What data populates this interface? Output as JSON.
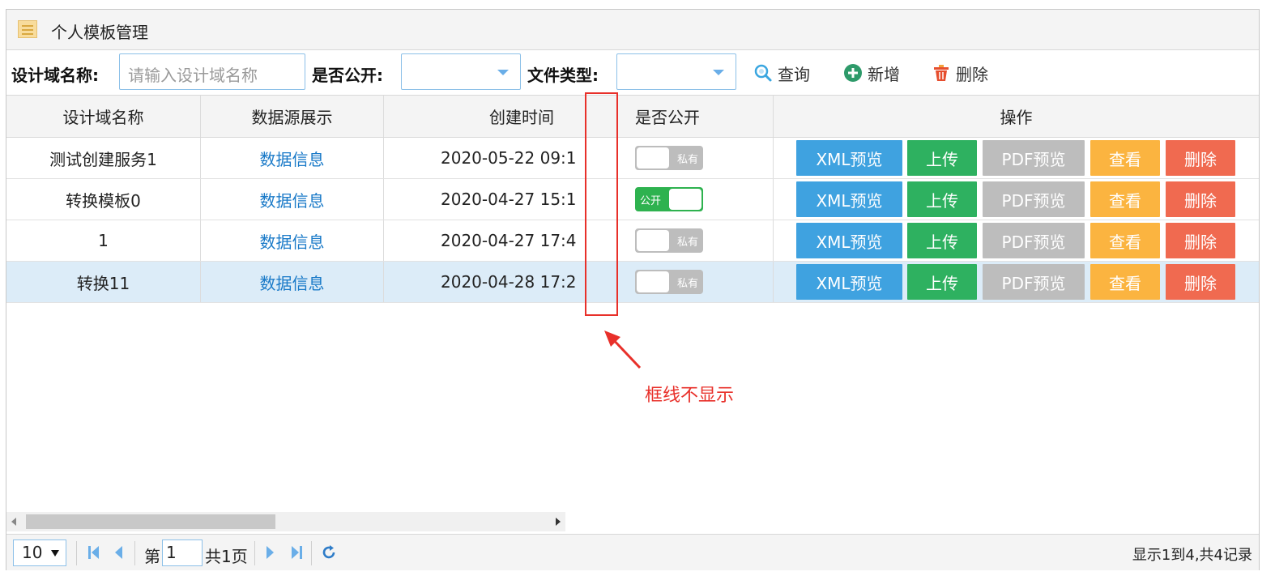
{
  "header": {
    "title": "个人模板管理",
    "icon": "list-icon"
  },
  "toolbar": {
    "name_label": "设计域名称:",
    "name_placeholder": "请输入设计域名称",
    "public_label": "是否公开:",
    "type_label": "文件类型:",
    "query_label": "查询",
    "add_label": "新增",
    "delete_label": "删除"
  },
  "table": {
    "columns": [
      "设计域名称",
      "数据源展示",
      "创建时间",
      "",
      "是否公开",
      "操作"
    ],
    "rows": [
      {
        "name": "测试创建服务1",
        "source": "数据信息",
        "created": "2020-05-22 09:1",
        "public": false,
        "switch_text": "私有"
      },
      {
        "name": "转换模板0",
        "source": "数据信息",
        "created": "2020-04-27 15:1",
        "public": true,
        "switch_text": "公开"
      },
      {
        "name": "1",
        "source": "数据信息",
        "created": "2020-04-27 17:4",
        "public": false,
        "switch_text": "私有"
      },
      {
        "name": "转换11",
        "source": "数据信息",
        "created": "2020-04-28 17:2",
        "public": false,
        "switch_text": "私有",
        "selected": true
      }
    ],
    "actions": {
      "xml_preview": "XML预览",
      "upload": "上传",
      "pdf_preview": "PDF预览",
      "view": "查看",
      "delete": "删除"
    }
  },
  "annotation": {
    "text": "框线不显示"
  },
  "pager": {
    "page_size": "10",
    "page_prefix": "第",
    "page_value": "1",
    "page_total": "共1页",
    "info": "显示1到4,共4记录"
  },
  "colors": {
    "xml": "#3fa2e0",
    "upload": "#2eb160",
    "pdf": "#bdbdbd",
    "view": "#fbb440",
    "delete": "#f06a50",
    "annotation": "#e8302a"
  }
}
